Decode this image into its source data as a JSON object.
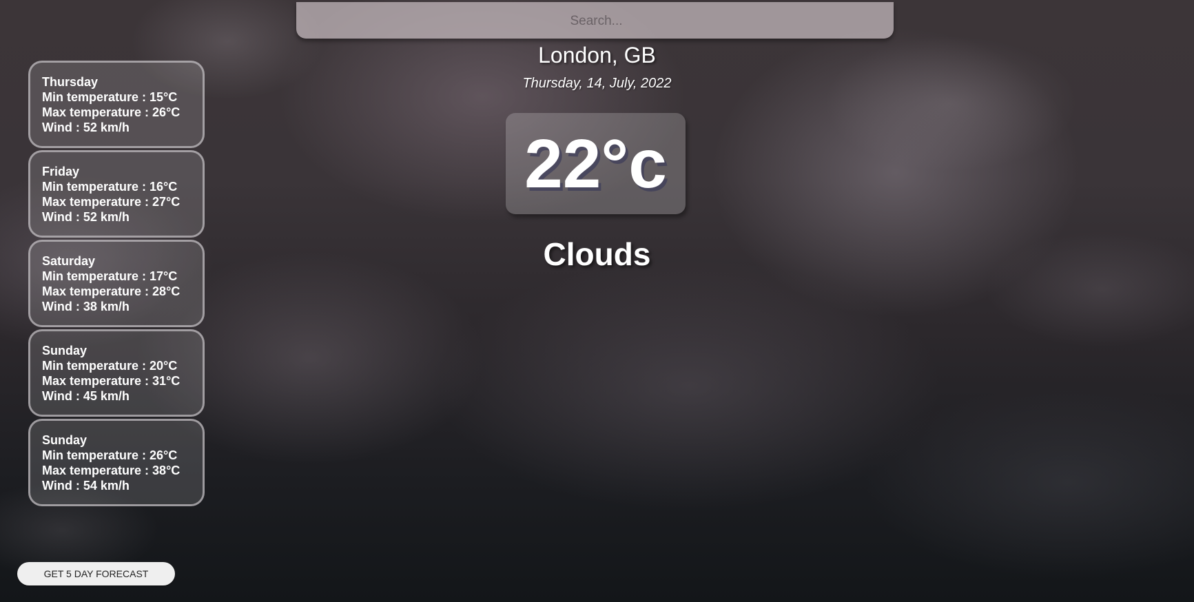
{
  "search": {
    "placeholder": "Search...",
    "value": ""
  },
  "location": "London, GB",
  "date": "Thursday, 14, July, 2022",
  "current": {
    "temperature": "22°c",
    "condition": "Clouds"
  },
  "forecast": [
    {
      "day": "Thursday",
      "min": "Min temperature : 15°C",
      "max": "Max temperature : 26°C",
      "wind": "Wind : 52 km/h"
    },
    {
      "day": "Friday",
      "min": "Min temperature : 16°C",
      "max": "Max temperature : 27°C",
      "wind": "Wind : 52 km/h"
    },
    {
      "day": "Saturday",
      "min": "Min temperature : 17°C",
      "max": "Max temperature : 28°C",
      "wind": "Wind : 38 km/h"
    },
    {
      "day": "Sunday",
      "min": "Min temperature : 20°C",
      "max": "Max temperature : 31°C",
      "wind": "Wind : 45 km/h"
    },
    {
      "day": "Sunday",
      "min": "Min temperature : 26°C",
      "max": "Max temperature : 38°C",
      "wind": "Wind : 54 km/h"
    }
  ],
  "forecast_button_label": "GET 5 DAY FORECAST"
}
